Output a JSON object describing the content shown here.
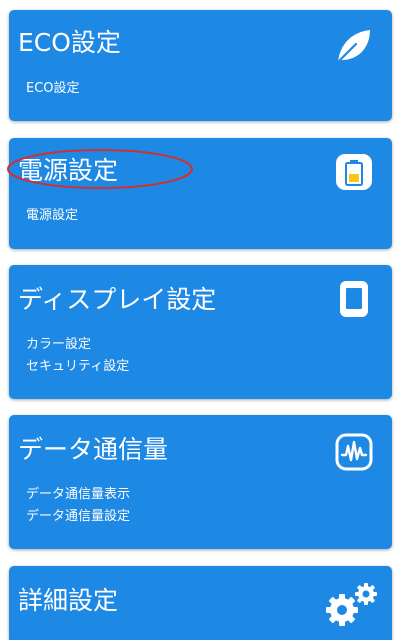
{
  "accent_color": "#1e88e5",
  "annotation_color": "#d32f2f",
  "cards": [
    {
      "title": "ECO設定",
      "icon": "leaf-icon",
      "items": [
        "ECO設定"
      ]
    },
    {
      "title": "電源設定",
      "icon": "battery-icon",
      "items": [
        "電源設定"
      ]
    },
    {
      "title": "ディスプレイ設定",
      "icon": "phone-screen-icon",
      "items": [
        "カラー設定",
        "セキュリティ設定"
      ]
    },
    {
      "title": "データ通信量",
      "icon": "activity-monitor-icon",
      "items": [
        "データ通信量表示",
        "データ通信量設定"
      ]
    },
    {
      "title": "詳細設定",
      "icon": "gears-icon",
      "items": []
    }
  ]
}
